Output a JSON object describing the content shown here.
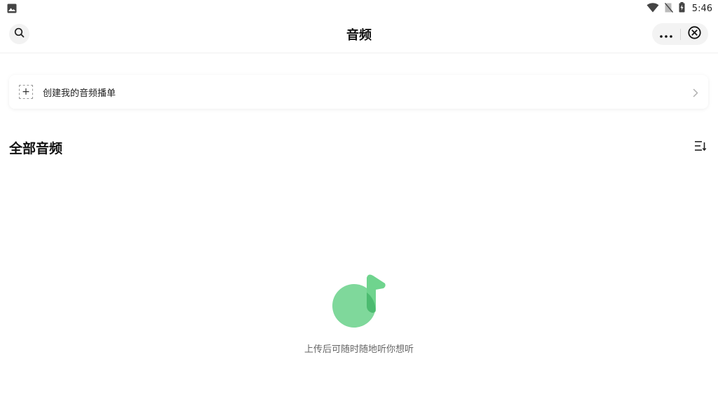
{
  "status_bar": {
    "time": "5:46",
    "left_icon": "image-notification-icon",
    "right_icons": [
      "wifi-icon",
      "no-sim-icon",
      "battery-charging-icon"
    ]
  },
  "nav": {
    "title": "音频",
    "search_icon": "search-icon",
    "more_icon": "more-dots-icon",
    "close_icon": "close-circle-icon"
  },
  "playlist": {
    "add_symbol": "+",
    "label": "创建我的音频播单"
  },
  "section": {
    "title": "全部音频",
    "sort_icon": "sort-icon"
  },
  "empty": {
    "text": "上传后可随时随地听你想听",
    "icon": "music-note-icon",
    "colors": {
      "circle": "#7fd89b",
      "flag": "#6fd48e",
      "overlap": "#4cbb70"
    }
  }
}
